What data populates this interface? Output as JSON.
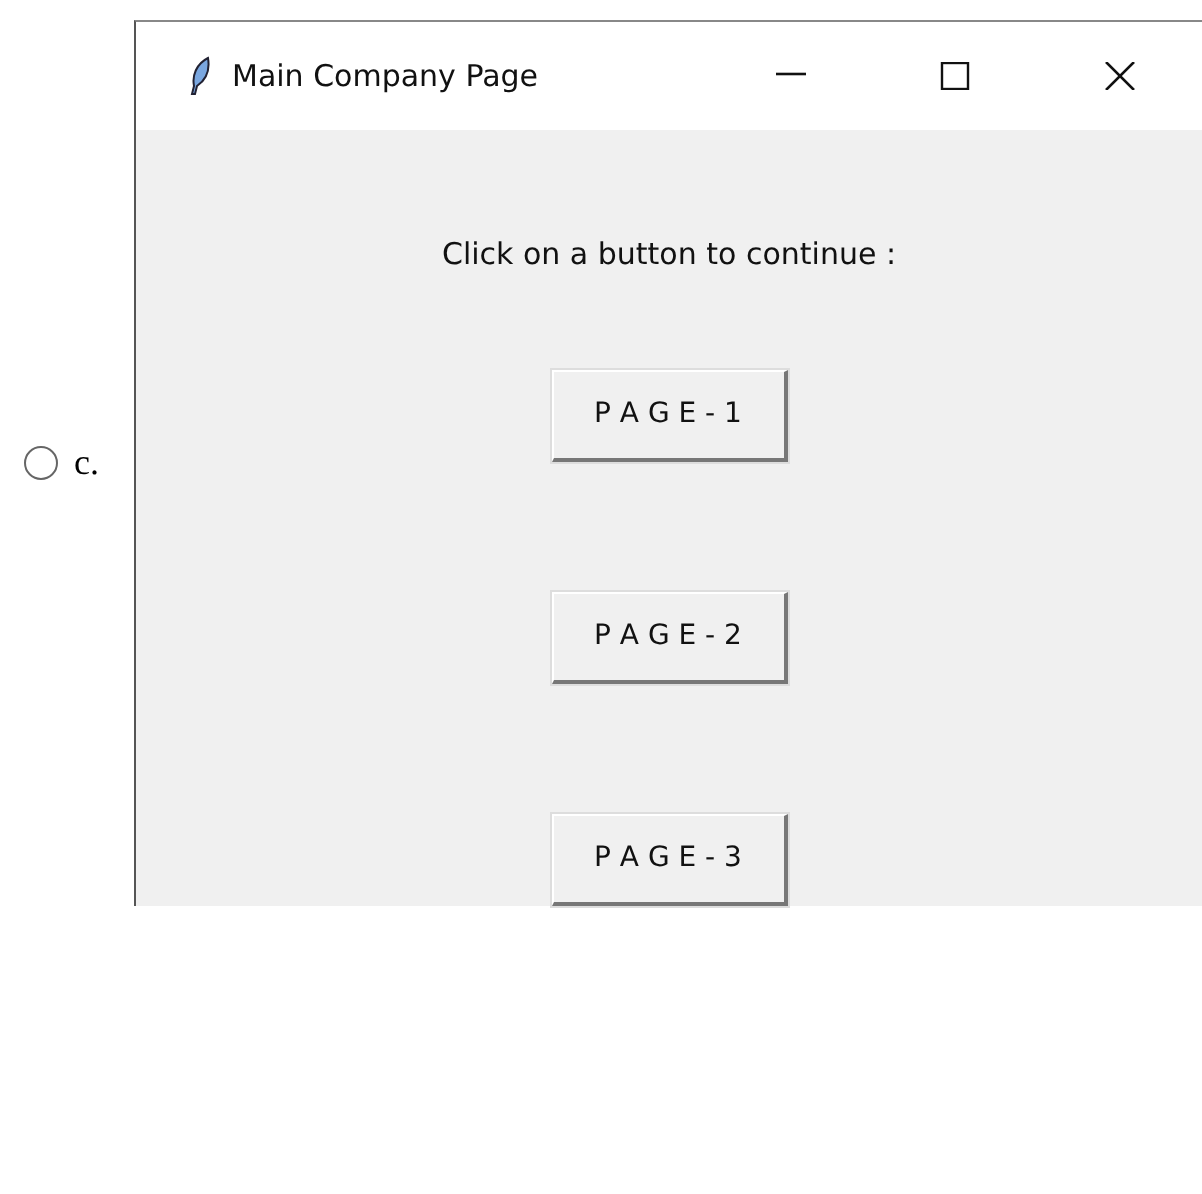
{
  "option": {
    "label": "c.",
    "selected": false
  },
  "window": {
    "title": "Main Company Page"
  },
  "prompt": "Click on a button to continue :",
  "buttons": [
    "P A G E - 1",
    "P A G E - 2",
    "P A G E - 3"
  ]
}
